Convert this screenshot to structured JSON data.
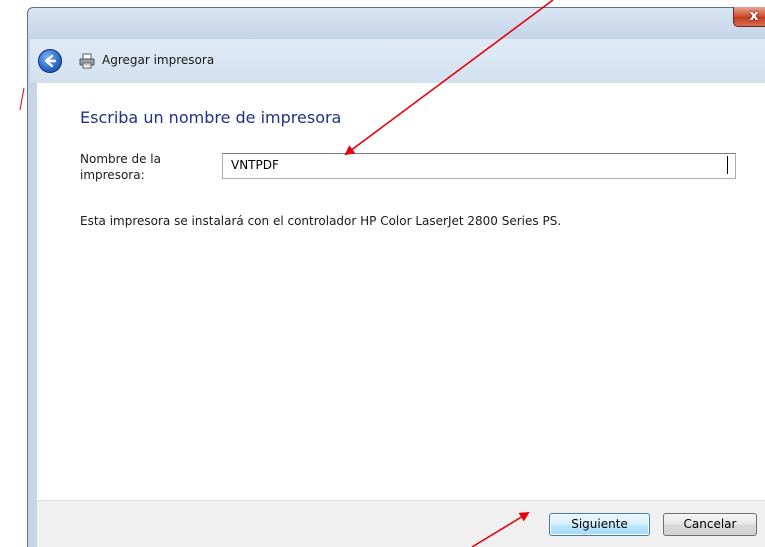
{
  "window": {
    "title": "Agregar impresora",
    "close_symbol": "x"
  },
  "wizard": {
    "heading": "Escriba un nombre de impresora",
    "name_label": "Nombre de la impresora:",
    "name_value": "VNTPDF",
    "driver_text": "Esta impresora se instalará con el controlador HP Color LaserJet 2800 Series PS."
  },
  "footer": {
    "next_label": "Siguiente",
    "cancel_label": "Cancelar"
  },
  "icons": {
    "back": "back-arrow-icon",
    "printer": "printer-icon",
    "close": "close-icon"
  },
  "colors": {
    "heading": "#1e3287",
    "annotation": "#e8000b",
    "close_button": "#c9452a"
  }
}
